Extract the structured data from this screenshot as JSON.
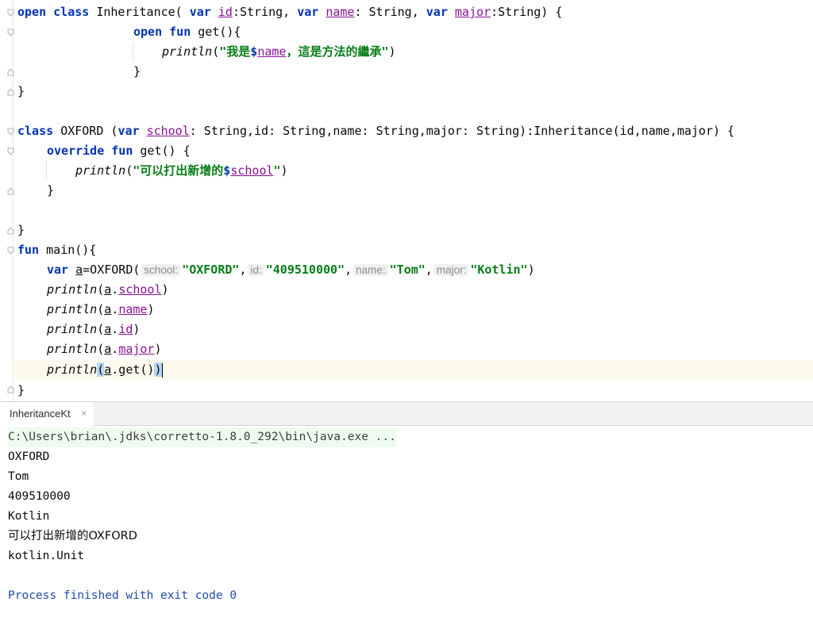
{
  "editor": {
    "lines": {
      "l1": {
        "kw_open": "open",
        "kw_class": "class",
        "name": "Inheritance(",
        "kw_var1": "var",
        "p_id": "id",
        "t1": ":String, ",
        "kw_var2": "var",
        "p_name": "name",
        "t2": ": String, ",
        "kw_var3": "var",
        "p_major": "major",
        "t3": ":String) {"
      },
      "l2": {
        "kw_open": "open",
        "kw_fun": "fun",
        "t": "get(){"
      },
      "l3": {
        "fn": "println",
        "paren": "(",
        "s1": "\"我是",
        "tmpl": "$",
        "p_name": "name",
        "s2": "，這是方法的繼承\"",
        "close": ")"
      },
      "l4": {
        "t": "}"
      },
      "l5": {
        "t": "}"
      },
      "l7": {
        "kw_class": "class",
        "name": "OXFORD (",
        "kw_var": "var",
        "p_school": "school",
        "rest": ": String,id: String,name: String,major: String):Inheritance(id,name,major) {"
      },
      "l8": {
        "kw_override": "override",
        "kw_fun": "fun",
        "t": "get() {"
      },
      "l9": {
        "fn": "println",
        "paren": "(",
        "s1": "\"可以打出新增的",
        "tmpl": "$",
        "p_school": "school",
        "s2": "\"",
        "close": ")"
      },
      "l10": {
        "t": "}"
      },
      "l12": {
        "t": "}"
      },
      "l13": {
        "kw_fun": "fun",
        "t": "main(){"
      },
      "l14": {
        "kw_var": "var",
        "v": "a",
        "t1": "=OXFORD(",
        "hint_school": "school:",
        "s_school": "\"OXFORD\"",
        "c1": ",",
        "hint_id": "id:",
        "s_id": "\"409510000\"",
        "c2": ",",
        "hint_name": "name:",
        "s_name": "\"Tom\"",
        "c3": ",",
        "hint_major": "major:",
        "s_major": "\"Kotlin\"",
        "close": ")"
      },
      "l15": {
        "fn": "println",
        "open": "(",
        "v": "a",
        "dot": ".",
        "p": "school",
        "close": ")"
      },
      "l16": {
        "fn": "println",
        "open": "(",
        "v": "a",
        "dot": ".",
        "p": "name",
        "close": ")"
      },
      "l17": {
        "fn": "println",
        "open": "(",
        "v": "a",
        "dot": ".",
        "p": "id",
        "close": ")"
      },
      "l18": {
        "fn": "println",
        "open": "(",
        "v": "a",
        "dot": ".",
        "p": "major",
        "close": ")"
      },
      "l19": {
        "fn": "println",
        "open": "(",
        "v": "a",
        "t": ".get()",
        "close": ")"
      },
      "l20": {
        "t": "}"
      }
    }
  },
  "run_panel": {
    "tab_label": "InheritanceKt",
    "close_glyph": "×",
    "console": [
      "C:\\Users\\brian\\.jdks\\corretto-1.8.0_292\\bin\\java.exe ...",
      "OXFORD",
      "Tom",
      "409510000",
      "Kotlin",
      "可以打出新增的OXFORD",
      "kotlin.Unit",
      "",
      "Process finished with exit code 0"
    ]
  },
  "colors": {
    "keyword": "#0033b3",
    "string": "#067d17",
    "property": "#871094",
    "current_line": "#fcfaed",
    "console_finished": "#1f4ca8"
  }
}
